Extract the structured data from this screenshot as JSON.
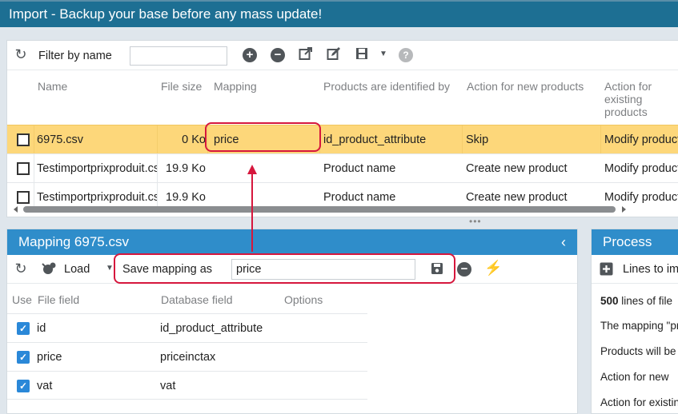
{
  "title": "Import - Backup your base before any mass update!",
  "files": {
    "toolbar": {
      "filter_label": "Filter by name",
      "filter_value": "",
      "icons": [
        "refresh-icon",
        "add-icon",
        "remove-icon",
        "export-icon",
        "edit-icon",
        "save-icon",
        "dropdown-icon",
        "help-icon"
      ],
      "help_glyph": "?"
    },
    "columns": [
      "Name",
      "File size",
      "Mapping",
      "Products are identified by",
      "Action for new products",
      "Action for existing products"
    ],
    "rows": [
      {
        "name": "6975.csv",
        "size": "0 Ko",
        "mapping": "price",
        "identified_by": "id_product_attribute",
        "action_new": "Skip",
        "action_existing": "Modify products",
        "selected": true
      },
      {
        "name": "Testimportprixproduit.csv",
        "size": "19.9 Ko",
        "mapping": "",
        "identified_by": "Product name",
        "action_new": "Create new product",
        "action_existing": "Modify products",
        "selected": false
      },
      {
        "name": "Testimportprixproduit.csv",
        "size": "19.9 Ko",
        "mapping": "",
        "identified_by": "Product name",
        "action_new": "Create new product",
        "action_existing": "Modify products",
        "selected": false
      }
    ]
  },
  "mapping": {
    "title": "Mapping 6975.csv",
    "load_label": "Load",
    "save_label": "Save mapping as",
    "save_value": "price",
    "columns": [
      "Use",
      "File field",
      "Database field",
      "Options"
    ],
    "rows": [
      {
        "file_field": "id",
        "db_field": "id_product_attribute",
        "checked": true
      },
      {
        "file_field": "price",
        "db_field": "priceinctax",
        "checked": true
      },
      {
        "file_field": "vat",
        "db_field": "vat",
        "checked": true
      }
    ]
  },
  "process": {
    "title": "Process",
    "add_label": "Lines to import",
    "lines": [
      {
        "bold": "500",
        "rest": " lines of file"
      },
      {
        "bold": "",
        "rest": "The mapping \"price\""
      },
      {
        "bold": "",
        "rest": "Products will be"
      },
      {
        "bold": "",
        "rest": "Action for new"
      },
      {
        "bold": "",
        "rest": "Action for existing"
      }
    ]
  },
  "colors": {
    "title_bg": "#1d6f93",
    "panel_header": "#2f8dca",
    "selected_row": "#fdd77a",
    "annotation": "#d6173d",
    "checkbox": "#2a88d8"
  }
}
